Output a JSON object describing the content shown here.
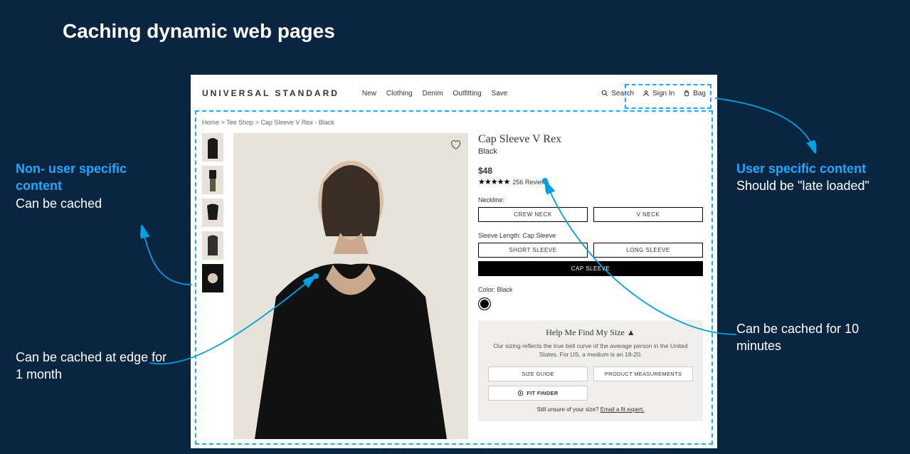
{
  "slide": {
    "title": "Caching dynamic web pages"
  },
  "annotations": {
    "left_top_heading": "Non- user specific content",
    "left_top_sub": "Can be cached",
    "left_bot": "Can be cached at edge for 1 month",
    "right_top_heading": "User specific content",
    "right_top_sub": "Should be \"late loaded\"",
    "right_bot": "Can be cached for 10 minutes"
  },
  "page": {
    "brand": "UNIVERSAL STANDARD",
    "nav": [
      "New",
      "Clothing",
      "Denim",
      "Outfitting",
      "Save"
    ],
    "search_label": "Search",
    "signin_label": "Sign In",
    "bag_label": "Bag",
    "breadcrumbs": "Home  >  Tee Shop  >  Cap Sleeve V Rex - Black",
    "product": {
      "name": "Cap Sleeve V Rex",
      "variant": "Black",
      "price": "$48",
      "reviews_count": "256 Reviews",
      "neckline_label": "Neckline:",
      "neckline_options": [
        "CREW NECK",
        "V NECK"
      ],
      "sleeve_label": "Sleeve Length: Cap Sleeve",
      "sleeve_options": [
        "SHORT SLEEVE",
        "LONG SLEEVE",
        "CAP SLEEVE"
      ],
      "sleeve_selected_index": 2,
      "color_label": "Color: Black"
    },
    "sizebox": {
      "title": "Help Me Find My Size  ▲",
      "blurb": "Our sizing reflects the true bell curve of the average person in the United States. For US, a medium is an 18-20.",
      "btn_size_guide": "SIZE GUIDE",
      "btn_measurements": "PRODUCT MEASUREMENTS",
      "btn_fit_finder": "FIT FINDER",
      "foot_prefix": "Still unsure of your size? ",
      "foot_link": "Email a fit expert."
    }
  }
}
